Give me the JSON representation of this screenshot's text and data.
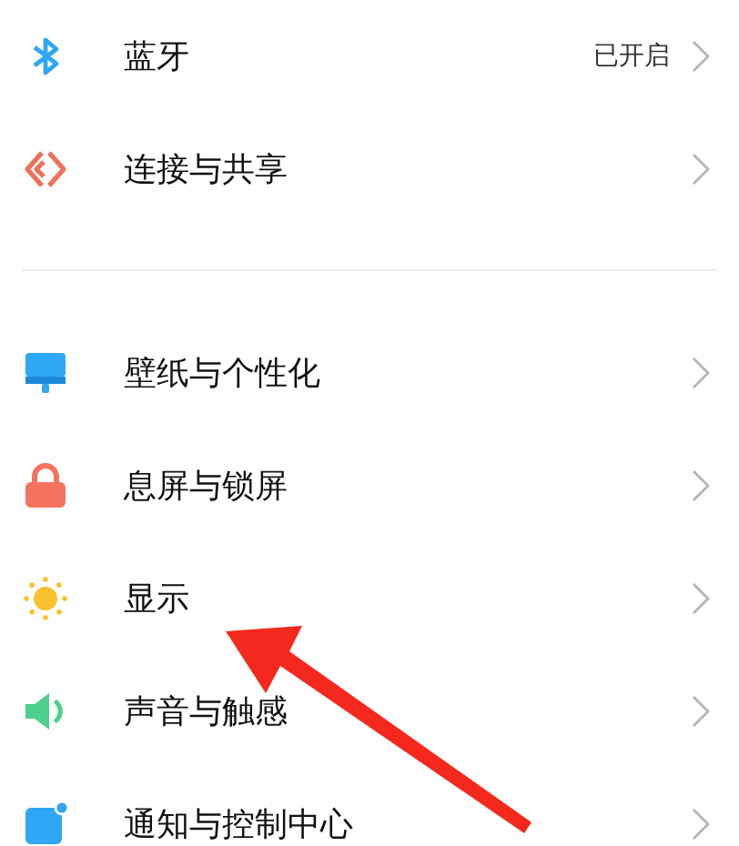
{
  "groups": [
    {
      "items": [
        {
          "kind": "bluetooth",
          "label": "蓝牙",
          "value": "已开启"
        },
        {
          "kind": "share",
          "label": "连接与共享"
        }
      ]
    },
    {
      "items": [
        {
          "kind": "wallpaper",
          "label": "壁纸与个性化"
        },
        {
          "kind": "lock",
          "label": "息屏与锁屏"
        },
        {
          "kind": "display",
          "label": "显示"
        },
        {
          "kind": "sound",
          "label": "声音与触感"
        },
        {
          "kind": "notification",
          "label": "通知与控制中心"
        }
      ]
    }
  ],
  "annotation": {
    "kind": "arrow"
  }
}
